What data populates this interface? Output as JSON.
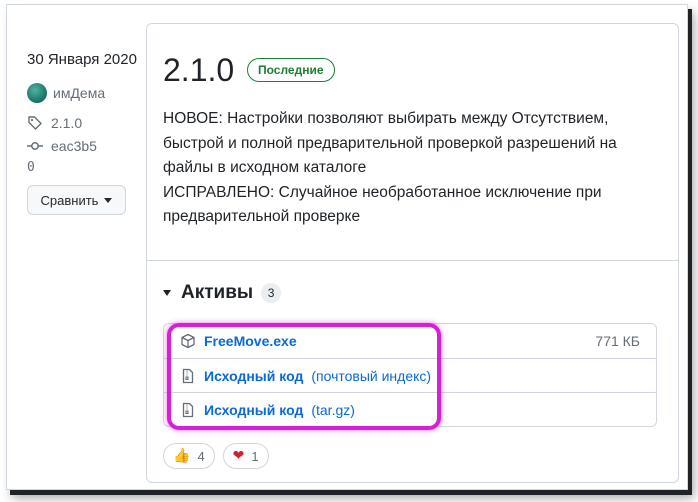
{
  "sidebar": {
    "date": "30 Января 2020",
    "author": "имДема",
    "tag": "2.1.0",
    "commit": "eac3b5",
    "zero": "0",
    "compare_label": "Сравнить"
  },
  "release": {
    "version": "2.1.0",
    "badge": "Последние",
    "notes": [
      "НОВОЕ: Настройки позволяют выбирать между Отсутствием,",
      "быстрой и полной предварительной проверкой разрешений на",
      "файлы в исходном каталоге",
      "ИСПРАВЛЕНО: Случайное необработанное исключение при",
      "предварительной проверке"
    ]
  },
  "assets": {
    "title": "Активы",
    "count": "3",
    "items": [
      {
        "name": "FreeMove.exe",
        "hint": "",
        "size": "771 КБ",
        "icon": "package-icon"
      },
      {
        "name": "Исходный код",
        "hint": "(почтовый индекс)",
        "size": "",
        "icon": "file-zip-icon"
      },
      {
        "name": "Исходный код",
        "hint": "(tar.gz)",
        "size": "",
        "icon": "file-zip-icon"
      }
    ]
  },
  "reactions": [
    {
      "emoji": "👍",
      "count": "4",
      "icon": "thumbs-up-icon"
    },
    {
      "emoji": "❤",
      "count": "1",
      "icon": "heart-icon"
    }
  ],
  "colors": {
    "accent_link": "#0969da",
    "latest_green": "#1a7f37",
    "highlight_magenta": "#d61fd6"
  }
}
